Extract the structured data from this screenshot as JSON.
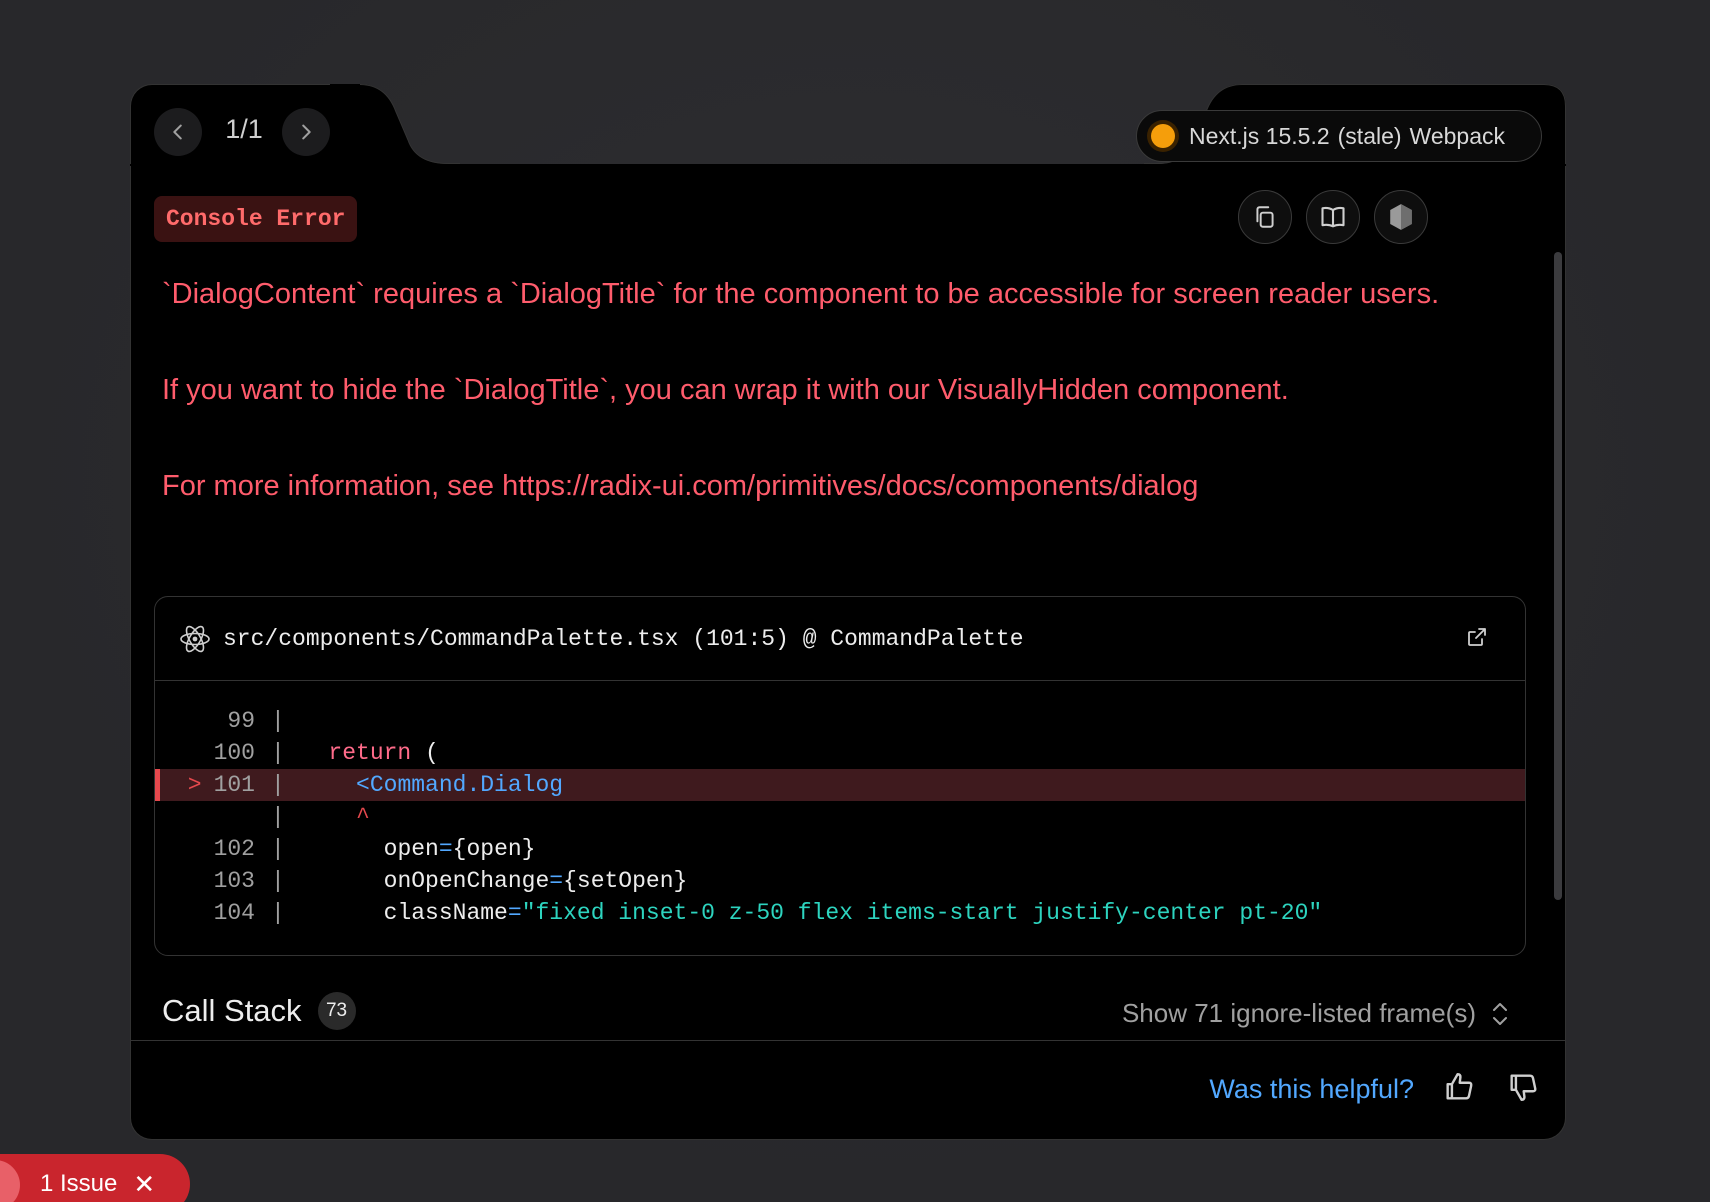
{
  "nav": {
    "counter": "1/1",
    "prev_icon": "chevron-left-icon",
    "next_icon": "chevron-right-icon"
  },
  "version": {
    "name": "Next.js 15.5.2",
    "status": "(stale)",
    "bundler": "Webpack",
    "dot_color": "#f59e0b"
  },
  "badge": {
    "label": "Console Error"
  },
  "toolbar": {
    "copy_icon": "copy-icon",
    "docs_icon": "book-icon",
    "node_icon": "nodejs-icon"
  },
  "error": {
    "line1": "`DialogContent` requires a `DialogTitle` for the component to be accessible for screen reader users.",
    "line2": "If you want to hide the `DialogTitle`, you can wrap it with our VisuallyHidden component.",
    "line3": "For more information, see https://radix-ui.com/primitives/docs/components/dialog"
  },
  "code": {
    "file": "src/components/CommandPalette.tsx (101:5) @ CommandPalette",
    "lines": [
      {
        "num": "99",
        "code": ""
      },
      {
        "num": "100",
        "kw": "return",
        "rest": " ("
      },
      {
        "num": "101",
        "tag": "<Command.Dialog",
        "highlighted": true
      },
      {
        "num": "",
        "caret": "^"
      },
      {
        "num": "102",
        "attr": "open",
        "val": "{open}"
      },
      {
        "num": "103",
        "attr": "onOpenChange",
        "val": "{setOpen}"
      },
      {
        "num": "104",
        "attr": "className",
        "str": "\"fixed inset-0 z-50 flex items-start justify-center pt-20\""
      }
    ]
  },
  "callstack": {
    "title": "Call Stack",
    "count": "73",
    "toggle": "Show 71 ignore-listed frame(s)"
  },
  "footer": {
    "helpful": "Was this helpful?"
  },
  "issues": {
    "label": "1 Issue"
  },
  "colors": {
    "error": "#ff5c6c",
    "link": "#52a8ff",
    "string": "#2dd4bf",
    "highlight": "#3f1a1e"
  }
}
